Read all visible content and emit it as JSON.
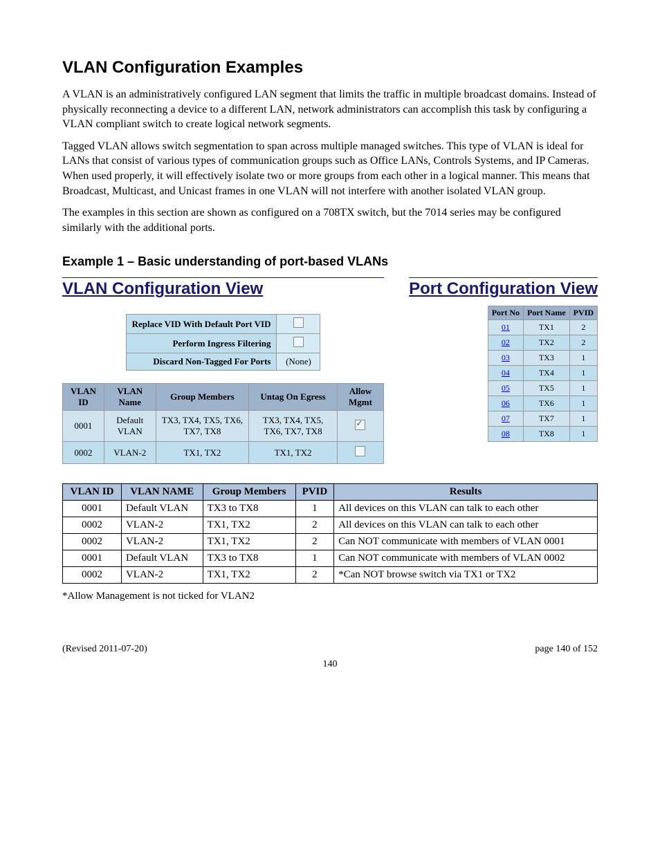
{
  "doc": {
    "title": "VLAN Configuration Examples",
    "intro": "A VLAN is an administratively configured LAN segment that limits the traffic in multiple broadcast domains. Instead of physically reconnecting a device to a different LAN, network administrators can accomplish this task by configuring a VLAN compliant switch to create logical network segments.",
    "tagged_para": "Tagged VLAN allows switch segmentation to span across multiple managed switches. This type of VLAN is ideal for LANs that consist of various types of communication groups such as Office LANs, Controls Systems, and IP Cameras. When used properly, it will effectively isolate two or more groups from each other in a logical manner. This means that Broadcast, Multicast, and Unicast frames in one VLAN will not interfere with another isolated VLAN group.",
    "config_para": "The examples in this section are shown as configured on a 708TX switch, but the 7014 series may be configured similarly with the additional ports."
  },
  "example": {
    "title": "Example 1 – Basic understanding of port-based VLANs"
  },
  "headings": {
    "vlan": "VLAN Configuration View",
    "port": "Port Configuration View"
  },
  "filters": {
    "replace_label": "Replace VID With Default Port VID",
    "ingress_label": "Perform Ingress Filtering",
    "discard_label": "Discard Non-Tagged For Ports",
    "discard_value": "(None)"
  },
  "vlan_table": {
    "headers": {
      "id": "VLAN ID",
      "name": "VLAN Name",
      "members": "Group Members",
      "untag": "Untag On Egress",
      "allow": "Allow Mgmt"
    },
    "rows": [
      {
        "id": "0001",
        "name": "Default VLAN",
        "members": "TX3, TX4, TX5, TX6, TX7, TX8",
        "untag": "TX3, TX4, TX5, TX6, TX7, TX8",
        "allow_checked": true
      },
      {
        "id": "0002",
        "name": "VLAN-2",
        "members": "TX1, TX2",
        "untag": "TX1, TX2",
        "allow_checked": false
      }
    ]
  },
  "port_table": {
    "headers": {
      "no": "Port No",
      "name": "Port Name",
      "pvid": "PVID"
    },
    "rows": [
      {
        "no": "01",
        "name": "TX1",
        "pvid": "2"
      },
      {
        "no": "02",
        "name": "TX2",
        "pvid": "2"
      },
      {
        "no": "03",
        "name": "TX3",
        "pvid": "1"
      },
      {
        "no": "04",
        "name": "TX4",
        "pvid": "1"
      },
      {
        "no": "05",
        "name": "TX5",
        "pvid": "1"
      },
      {
        "no": "06",
        "name": "TX6",
        "pvid": "1"
      },
      {
        "no": "07",
        "name": "TX7",
        "pvid": "1"
      },
      {
        "no": "08",
        "name": "TX8",
        "pvid": "1"
      }
    ]
  },
  "simple": {
    "headers": {
      "vid": "VLAN ID",
      "name": "VLAN NAME",
      "members": "Group Members",
      "pvid": "PVID",
      "results": "Results"
    },
    "rows": [
      {
        "vid": "0001",
        "name": "Default VLAN",
        "members": "TX3 to TX8",
        "pvid": "1",
        "results": "All devices on this VLAN can talk to each other"
      },
      {
        "vid": "0002",
        "name": "VLAN-2",
        "members": "TX1, TX2",
        "pvid": "2",
        "results": "All devices on this VLAN can talk to each other"
      },
      {
        "vid": "0002",
        "name": "VLAN-2",
        "members": "TX1, TX2",
        "pvid": "2",
        "results": "Can NOT communicate with members of VLAN 0001"
      },
      {
        "vid": "0001",
        "name": "Default VLAN",
        "members": "TX3 to TX8",
        "pvid": "1",
        "results": "Can NOT communicate with members of VLAN 0002"
      },
      {
        "vid": "0002",
        "name": "VLAN-2",
        "members": "TX1, TX2",
        "pvid": "2",
        "results": "*Can NOT browse switch via TX1 or TX2"
      }
    ]
  },
  "footnote": "*Allow Management is not ticked for VLAN2",
  "footer": {
    "left": "(Revised 2011-07-20)",
    "right": "page 140 of 152",
    "pagenum": "140"
  }
}
